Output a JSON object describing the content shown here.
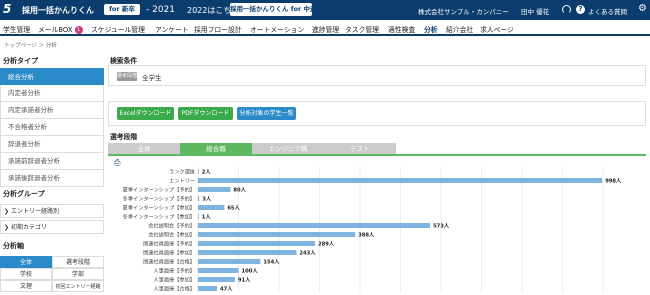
{
  "header": {
    "logo_num": "5",
    "logo_text": "採用一括かんりくん",
    "logo_badge": "for 新卒",
    "year": "- 2021",
    "link_2022": "2022はこちら",
    "promo": "採用一括かんりくん for 中途",
    "company": "株式会社サンプル・カンパニー",
    "user": "田中 優花",
    "faq": "よくある質問",
    "faq_icon_glyph": "?",
    "gear_glyph": "⚙"
  },
  "menu": {
    "items": [
      {
        "label": "学生管理"
      },
      {
        "label": "メールBOX",
        "badge": "1"
      },
      {
        "label": "スケジュール管理"
      },
      {
        "label": "アンケート"
      },
      {
        "label": "採用フロー設計"
      },
      {
        "label": "オートメーション"
      },
      {
        "label": "進捗管理"
      },
      {
        "label": "タスク管理"
      },
      {
        "label": "適性検査"
      },
      {
        "label": "分析",
        "active": true
      },
      {
        "label": "紹介会社"
      },
      {
        "label": "求人ページ"
      }
    ]
  },
  "breadcrumb": "トップページ ＞ 分析",
  "sidebar": {
    "type_title": "分析タイプ",
    "types": [
      "総合分析",
      "内定者分析",
      "内定承諾者分析",
      "不合格者分析",
      "辞退者分析",
      "承諾前辞退者分析",
      "承諾後辞退者分析"
    ],
    "group_title": "分析グループ",
    "groups": [
      "エントリー経路別",
      "初期カテゴリ"
    ],
    "group_arrow": "❯",
    "axis_title": "分析軸",
    "axis_cells": [
      "全体",
      "選考段階",
      "学校",
      "学部",
      "文理",
      "初回エントリー経路"
    ]
  },
  "main": {
    "cond_title": "検索条件",
    "cond_label": "選考段階",
    "cond_value": "全学生",
    "buttons": [
      "Excelダウンロード",
      "PDFダウンロード",
      "分析対象の学生一覧"
    ],
    "stage_title": "選考段階",
    "tabs": [
      "全体",
      "総合職",
      "エンジニア職",
      "テスト"
    ],
    "print_glyph": "⎙"
  },
  "colors": {
    "header_bg": "#0a3d6e",
    "accent": "#2b8ac8",
    "tab_active": "#5fb85f",
    "bar": "#7fb3e0",
    "btn_green": "#3aaa4a",
    "btn_blue": "#2b8ac8",
    "badge": "#d0357a"
  },
  "chart_data": {
    "type": "bar",
    "orientation": "horizontal",
    "categories": [
      "ランク選抜",
      "エントリー",
      "夏季インターンシップ【予約】",
      "冬季インターンシップ【予約】",
      "夏季インターンシップ【参加】",
      "冬季インターンシップ【参加】",
      "会社説明会【予約】",
      "会社説明会【参加】",
      "関連社員面接【予約】",
      "関連社員面接【参加】",
      "関連社員面接【合格】",
      "人事面接【予約】",
      "人事面接【参加】",
      "人事面接【合格】"
    ],
    "values": [
      2,
      998,
      80,
      3,
      65,
      1,
      573,
      388,
      289,
      243,
      154,
      100,
      91,
      47
    ],
    "value_labels": [
      "2人",
      "998人",
      "80人",
      "3人",
      "65人",
      "1人",
      "573人",
      "388人",
      "289人",
      "243人",
      "154人",
      "100人",
      "91人",
      "47人"
    ],
    "xlim": [
      0,
      1000
    ],
    "grid": true
  }
}
